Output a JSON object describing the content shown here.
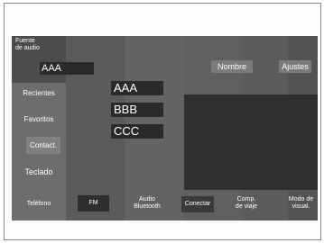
{
  "header": {
    "source_label": "Fuente\nde audio",
    "source_value": "AAA",
    "name_button": "Nombre",
    "settings_button": "Ajustes"
  },
  "sidebar": {
    "items": [
      "Recientes",
      "Favoritos",
      "Contact.",
      "Teclado",
      "Teléfono"
    ]
  },
  "list": {
    "items": [
      "AAA",
      "BBB",
      "CCC"
    ]
  },
  "bottom_bar": {
    "items": [
      "FM",
      "Audio\nBluetooth",
      "Conectar",
      "Comp.\nde viaje",
      "Modo de\nvisual."
    ]
  }
}
